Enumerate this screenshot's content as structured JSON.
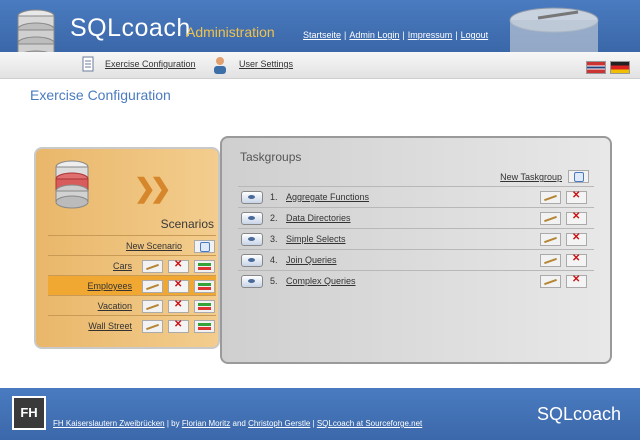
{
  "header": {
    "brand_sql": "SQL",
    "brand_coach": "coach",
    "subtitle": "Administration",
    "nav": [
      {
        "label": "Startseite"
      },
      {
        "label": "Admin Login"
      },
      {
        "label": "Impressum"
      },
      {
        "label": "Logout"
      }
    ],
    "nav_separator": "|"
  },
  "subnav": {
    "exercise_config": "Exercise Configuration",
    "user_settings": "User Settings"
  },
  "page": {
    "title": "Exercise Configuration"
  },
  "scenarios": {
    "heading": "Scenarios",
    "new_label": "New Scenario",
    "items": [
      {
        "name": "Cars",
        "selected": false
      },
      {
        "name": "Employees",
        "selected": true
      },
      {
        "name": "Vacation",
        "selected": false
      },
      {
        "name": "Wall Street",
        "selected": false
      }
    ]
  },
  "taskgroups": {
    "heading": "Taskgroups",
    "new_label": "New Taskgroup",
    "items": [
      {
        "num": "1.",
        "name": "Aggregate Functions"
      },
      {
        "num": "2.",
        "name": "Data Directories"
      },
      {
        "num": "3.",
        "name": "Simple Selects"
      },
      {
        "num": "4.",
        "name": "Join Queries"
      },
      {
        "num": "5.",
        "name": "Complex Queries"
      }
    ]
  },
  "footer": {
    "fh_logo": "FH",
    "inst": "FH Kaiserslautern Zweibrücken",
    "sep1": " | by ",
    "author1": "Florian Moritz",
    "and": " and ",
    "author2": "Christoph Gerstle",
    "sep2": " | ",
    "sf": "SQLcoach at Sourceforge.net",
    "brand": "SQLcoach"
  },
  "colors": {
    "header_blue": "#4a7bc0",
    "accent_orange": "#f0c24b",
    "selected_row": "#f0a832"
  }
}
